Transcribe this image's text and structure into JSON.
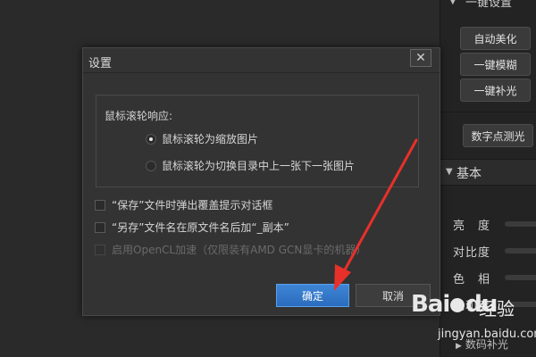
{
  "right_panel": {
    "header": "一键设置",
    "buttons": [
      "自动美化",
      "一键模糊",
      "一键补光"
    ],
    "extra_button": "数字点测光",
    "section": "基本",
    "adjustments": [
      "亮　度",
      "对比度",
      "色　相",
      "饱和度"
    ],
    "bottom_section": "数码补光"
  },
  "dialog": {
    "title": "设置",
    "close_symbol": "✕",
    "group_label": "鼠标滚轮响应:",
    "radios": [
      {
        "label": "鼠标滚轮为缩放图片",
        "checked": true
      },
      {
        "label": "鼠标滚轮为切换目录中上一张下一张图片",
        "checked": false
      }
    ],
    "checkboxes": [
      {
        "label": "“保存”文件时弹出覆盖提示对话框",
        "checked": false,
        "disabled": false
      },
      {
        "label": "“另存”文件名在原文件名后加“_副本”",
        "checked": false,
        "disabled": false
      },
      {
        "label": "启用OpenCL加速（仅限装有AMD GCN显卡的机器）",
        "checked": false,
        "disabled": true
      }
    ],
    "ok_label": "确定",
    "cancel_label": "取消"
  },
  "watermark": {
    "logo": "Bai",
    "logo_tail": "du",
    "sub": "经验",
    "url": "jingyan.baidu.com"
  },
  "colors": {
    "primary_button": "#2f75c8",
    "annotation_arrow": "#e8302a"
  }
}
